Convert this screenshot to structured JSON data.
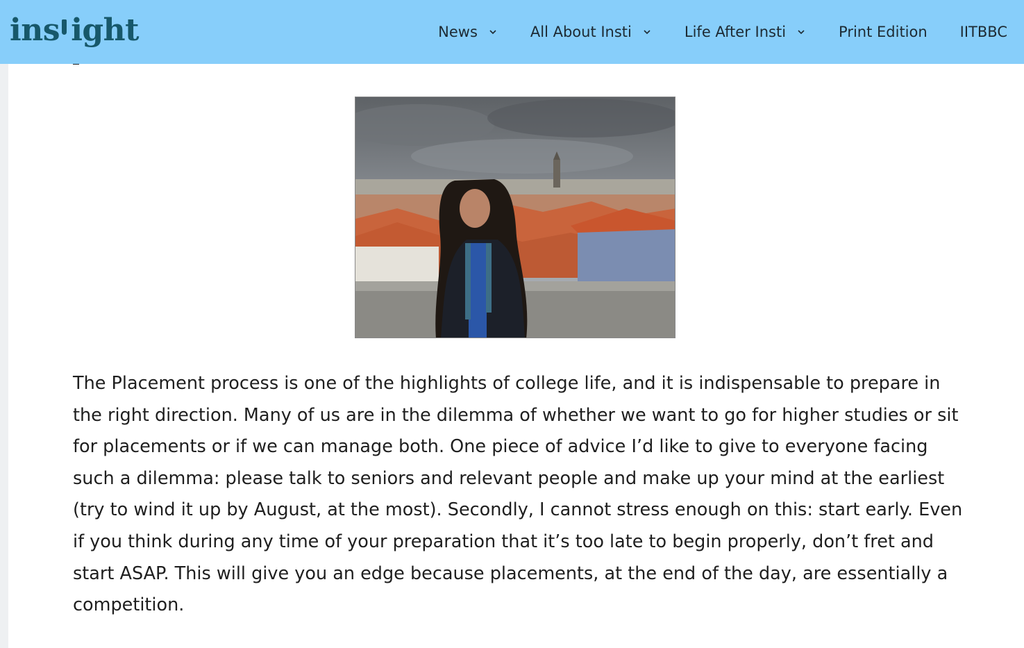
{
  "site": {
    "logo_text_part1": "ins",
    "logo_text_part2": "ight"
  },
  "nav": {
    "items": [
      {
        "label": "News",
        "has_dropdown": true,
        "icon": "chevron-down-icon"
      },
      {
        "label": "All About Insti",
        "has_dropdown": true,
        "icon": "chevron-down-icon"
      },
      {
        "label": "Life After Insti",
        "has_dropdown": true,
        "icon": "chevron-down-icon"
      },
      {
        "label": "Print Edition",
        "has_dropdown": false
      },
      {
        "label": "IITBBC",
        "has_dropdown": false
      }
    ]
  },
  "colors": {
    "navbar_bg": "#87cefa",
    "logo": "#17586a",
    "text": "#1f1f1f"
  },
  "article": {
    "paragraph": "The Placement process is one of the highlights of college life, and it is indispensable to prepare in the right direction. Many of us are in the dilemma of whether we want to go for higher studies or sit for placements or if we can manage both. One piece of advice I’d like to give to everyone facing such a dilemma: please talk to seniors and relevant people and make up your mind at the earliest (try to wind it up by August, at the most). Secondly, I cannot stress enough on this: start early. Even if you think during any time of your preparation that it’s too late to begin properly, don’t fret and start ASAP. This will give you an edge because placements, at the end of the day, are essentially a competition."
  }
}
